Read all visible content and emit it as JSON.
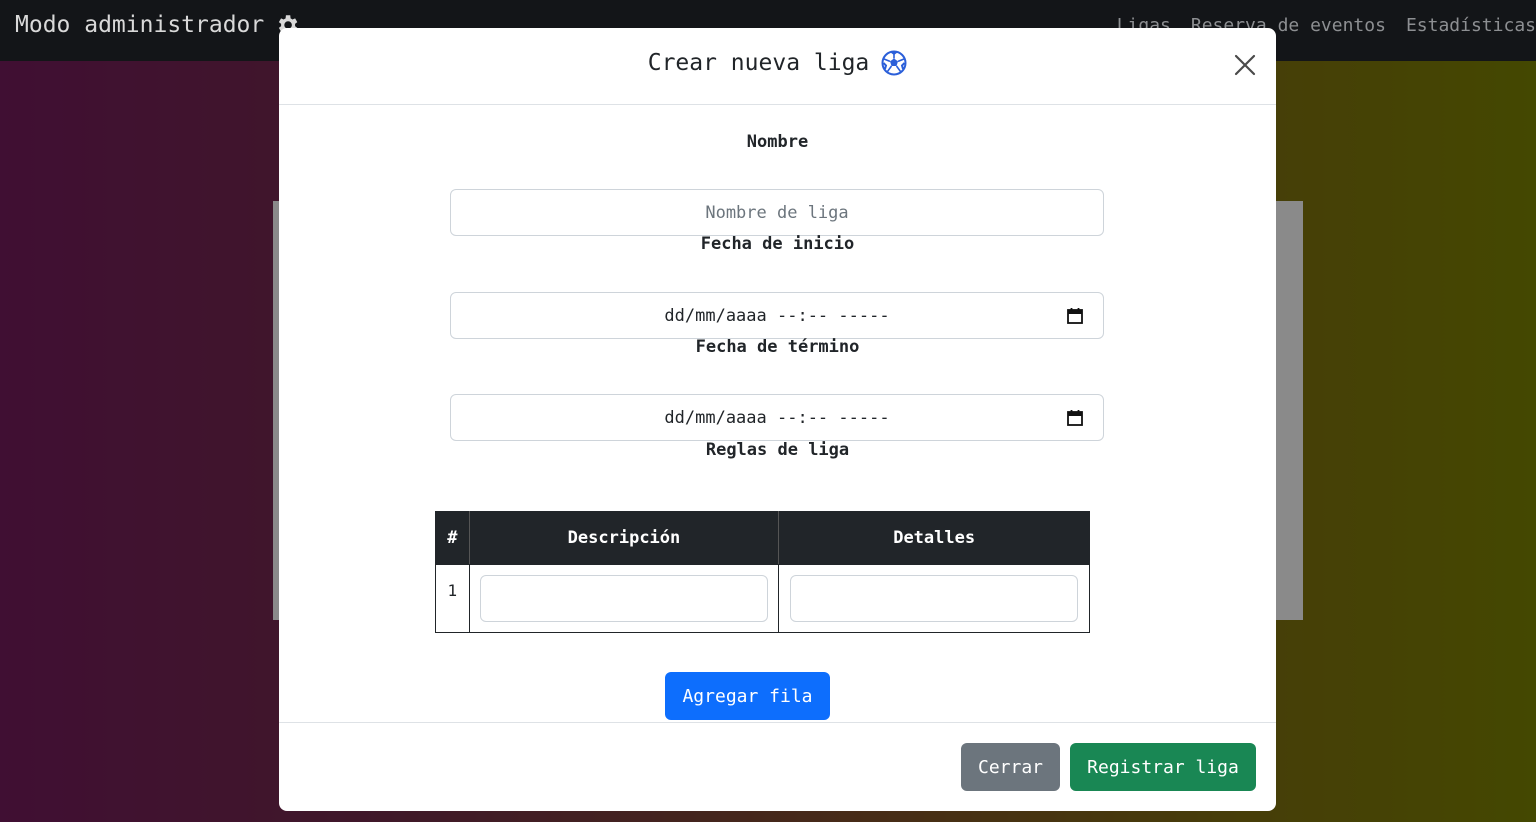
{
  "navbar": {
    "brand": "Modo administrador",
    "links": [
      "Ligas",
      "Reserva de eventos",
      "Estadísticas"
    ]
  },
  "modal": {
    "title": "Crear nueva liga",
    "fields": {
      "nombre_label": "Nombre",
      "nombre_placeholder": "Nombre de liga",
      "inicio_label": "Fecha de inicio",
      "inicio_value": "dd/mm/aaaa --:-- -----",
      "termino_label": "Fecha de término",
      "termino_value": "dd/mm/aaaa --:-- -----"
    },
    "rules": {
      "title": "Reglas de liga",
      "headers": [
        "#",
        "Descripción",
        "Detalles"
      ],
      "rows": [
        {
          "num": "1",
          "descripcion": "",
          "detalles": ""
        }
      ]
    },
    "add_row_label": "Agregar fila",
    "close_label": "Cerrar",
    "submit_label": "Registrar liga"
  },
  "colors": {
    "primary": "#0d6efd",
    "secondary": "#6c757d",
    "success": "#198754",
    "navbar": "#131518"
  }
}
